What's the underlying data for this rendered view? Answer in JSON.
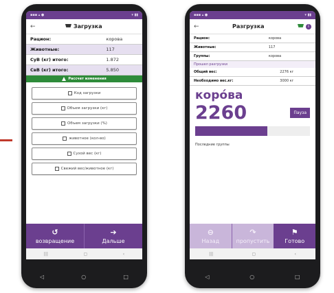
{
  "left_phone": {
    "title": "Загрузка",
    "rows": [
      {
        "key": "Рацион:",
        "value": "корова"
      },
      {
        "key": "Животные:",
        "value": "117"
      },
      {
        "key": "СуВ (кг) итого:",
        "value": "1.872"
      },
      {
        "key": "СвВ (кг) итого:",
        "value": "5.850"
      }
    ],
    "alert": "Рассчет изменения",
    "buttons": [
      "Код загрузки",
      "Объем загрузки (кг)",
      "Объем загрузки (%)",
      "животное (кол-во)",
      "Сухой вес (кг)",
      "Свежий вес/животное (кг)"
    ],
    "back_label": "возвращение",
    "next_label": "Дальше"
  },
  "right_phone": {
    "title": "Разгрузка",
    "rows": [
      {
        "key": "Рацион:",
        "value": "корова"
      },
      {
        "key": "Животные:",
        "value": "117"
      },
      {
        "key": "Группы:",
        "value": "корова"
      }
    ],
    "note": "Прошел разгрузки",
    "rows2": [
      {
        "key": "Общий вес:",
        "value": "2276 кг"
      },
      {
        "key": "Необходимо вес.кг:",
        "value": "3000 кг"
      }
    ],
    "feed_name": "корóва",
    "weight": "2260",
    "pause_label": "Пауза",
    "progress": 0.63,
    "last_groups": "Последние группы",
    "back_label": "Назад",
    "skip_label": "пропустить",
    "done_label": "Готово"
  },
  "colors": {
    "accent": "#6b3f8f",
    "alert": "#2e8b3a",
    "marker": "#c0392b"
  }
}
